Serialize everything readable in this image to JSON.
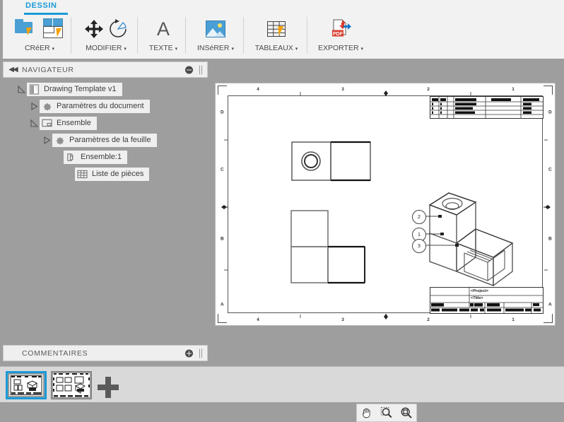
{
  "ribbon": {
    "tab": "DESSIN",
    "groups": [
      {
        "label": "CRéER",
        "caret": "▾",
        "icons": [
          "new-drawing-icon",
          "new-sheet-icon"
        ]
      },
      {
        "label": "MODIFIER",
        "caret": "▾",
        "icons": [
          "move-icon",
          "rotate-icon"
        ]
      },
      {
        "label": "TEXTE",
        "caret": "▾",
        "icons": [
          "text-icon"
        ]
      },
      {
        "label": "INSéRER",
        "caret": "▾",
        "icons": [
          "insert-image-icon"
        ]
      },
      {
        "label": "TABLEAUX",
        "caret": "▾",
        "icons": [
          "table-icon"
        ]
      },
      {
        "label": "EXPORTER",
        "caret": "▾",
        "icons": [
          "export-pdf-icon"
        ]
      }
    ]
  },
  "navigator": {
    "title": "NAVIGATEUR",
    "collapse_icon": "double-left-arrow-icon",
    "minimize_icon": "minus-circle-icon",
    "tree": [
      {
        "label": "Drawing Template v1",
        "icon": "drawing-icon",
        "state": "expanded",
        "indent": 0
      },
      {
        "label": "Paramètres du document",
        "icon": "gear-icon",
        "state": "collapsed",
        "indent": 1
      },
      {
        "label": "Ensemble",
        "icon": "sheet-icon",
        "state": "expanded",
        "indent": 1
      },
      {
        "label": "Paramètres de la feuille",
        "icon": "gear-icon",
        "state": "collapsed",
        "indent": 2
      },
      {
        "label": "Ensemble:1",
        "icon": "assembly-view-icon",
        "state": "leaf",
        "indent": 2
      },
      {
        "label": "Liste de pièces",
        "icon": "parts-table-icon",
        "state": "leaf",
        "indent": 3
      }
    ]
  },
  "comments": {
    "title": "COMMENTAIRES",
    "add_icon": "plus-circle-icon"
  },
  "sheet": {
    "zone_numbers": [
      "4",
      "3",
      "2",
      "1"
    ],
    "zone_letters": [
      "D",
      "C",
      "B",
      "A"
    ],
    "title_block": {
      "project_placeholder": "<Project>",
      "title_placeholder": "<Title>"
    },
    "balloons": [
      "2",
      "1",
      "3"
    ]
  },
  "view_toolbar": {
    "buttons": [
      {
        "name": "pan-icon",
        "title": "Pan"
      },
      {
        "name": "zoom-window-icon",
        "title": "Zoom window"
      },
      {
        "name": "zoom-fit-icon",
        "title": "Zoom fit"
      }
    ]
  },
  "sheet_tabs": {
    "tabs": [
      {
        "name": "sheet-thumbnail-1",
        "selected": true
      },
      {
        "name": "sheet-thumbnail-2",
        "selected": false
      }
    ],
    "add_icon": "plus-icon"
  },
  "colors": {
    "accent": "#1a9ad7",
    "panel": "#efefef",
    "workspace": "#9e9e9e",
    "ribbon": "#f2f2f2",
    "bolt": "#f5a200"
  }
}
